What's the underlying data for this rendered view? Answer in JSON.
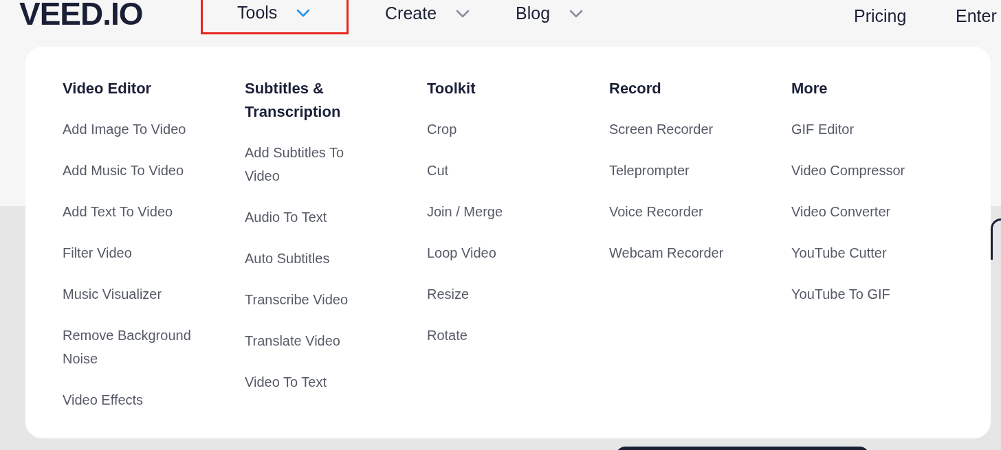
{
  "logo": "VEED.IO",
  "nav": [
    {
      "label": "Tools",
      "kind": "dropdown",
      "selected": true,
      "highlighted": true
    },
    {
      "label": "Create",
      "kind": "dropdown",
      "selected": false,
      "highlighted": false
    },
    {
      "label": "Blog",
      "kind": "dropdown",
      "selected": false,
      "highlighted": false
    }
  ],
  "nav_right": [
    {
      "label": "Pricing"
    },
    {
      "label": "Enter"
    }
  ],
  "menu": {
    "columns": [
      {
        "heading": "Video Editor",
        "items": [
          "Add Image To Video",
          "Add Music To Video",
          "Add Text To Video",
          "Filter Video",
          "Music Visualizer",
          "Remove Background Noise",
          "Video Effects"
        ]
      },
      {
        "heading": "Subtitles & Transcription",
        "items": [
          "Add Subtitles To Video",
          "Audio To Text",
          "Auto Subtitles",
          "Transcribe Video",
          "Translate Video",
          "Video To Text"
        ]
      },
      {
        "heading": "Toolkit",
        "items": [
          "Crop",
          "Cut",
          "Join / Merge",
          "Loop Video",
          "Resize",
          "Rotate"
        ]
      },
      {
        "heading": "Record",
        "items": [
          "Screen Recorder",
          "Teleprompter",
          "Voice Recorder",
          "Webcam Recorder"
        ]
      },
      {
        "heading": "More",
        "items": [
          "GIF Editor",
          "Video Compressor",
          "Video Converter",
          "YouTube Cutter",
          "YouTube To GIF"
        ]
      }
    ]
  }
}
